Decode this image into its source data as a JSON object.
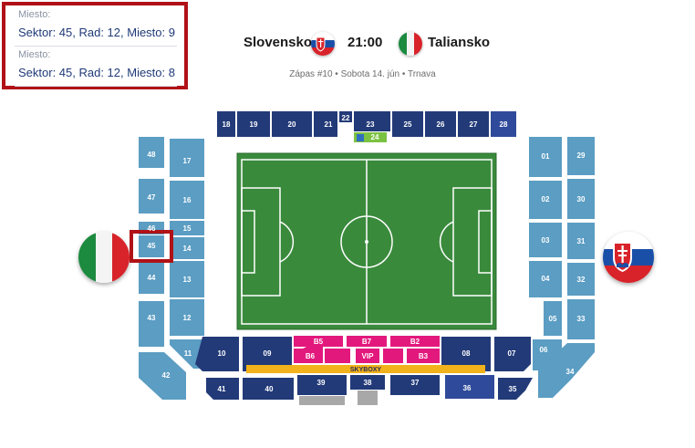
{
  "seats": [
    {
      "label": "Miesto:",
      "value": "Sektor: 45, Rad: 12, Miesto: 9"
    },
    {
      "label": "Miesto:",
      "value": "Sektor: 45, Rad: 12, Miesto: 8"
    }
  ],
  "match": {
    "home_team": "Slovensko",
    "away_team": "Taliansko",
    "time": "21:00",
    "info": "Zápas #10 • Sobota 14. jún • Trnava"
  },
  "colors": {
    "light_sector": "#5b9dc3",
    "dark_sector": "#223a78",
    "vip_sector": "#e3187d",
    "skybox": "#f2b21b",
    "pitch": "#3a8a3c",
    "highlight": "#b01217"
  },
  "sectors": {
    "s18": "18",
    "s19": "19",
    "s20": "20",
    "s21": "21",
    "s22": "22",
    "s23": "23",
    "s24": "24",
    "s25": "25",
    "s26": "26",
    "s27": "27",
    "s28": "28",
    "s48": "48",
    "s47": "47",
    "s46": "46",
    "s45": "45",
    "s44": "44",
    "s43": "43",
    "s42": "42",
    "s17": "17",
    "s16": "16",
    "s15": "15",
    "s14": "14",
    "s13": "13",
    "s12": "12",
    "s11": "11",
    "s01": "01",
    "s02": "02",
    "s03": "03",
    "s04": "04",
    "s05": "05",
    "s06": "06",
    "s29": "29",
    "s30": "30",
    "s31": "31",
    "s32": "32",
    "s33": "33",
    "s34": "34",
    "s10": "10",
    "s09": "09",
    "s08": "08",
    "s07": "07",
    "s41": "41",
    "s40": "40",
    "s39": "39",
    "s38": "38",
    "s37": "37",
    "s36": "36",
    "s35": "35",
    "b5": "B5",
    "b7": "B7",
    "b2": "B2",
    "b6": "B6",
    "vip": "VIP",
    "b3": "B3",
    "skyboxy": "SKYBOXY"
  },
  "selected_sector": "45"
}
